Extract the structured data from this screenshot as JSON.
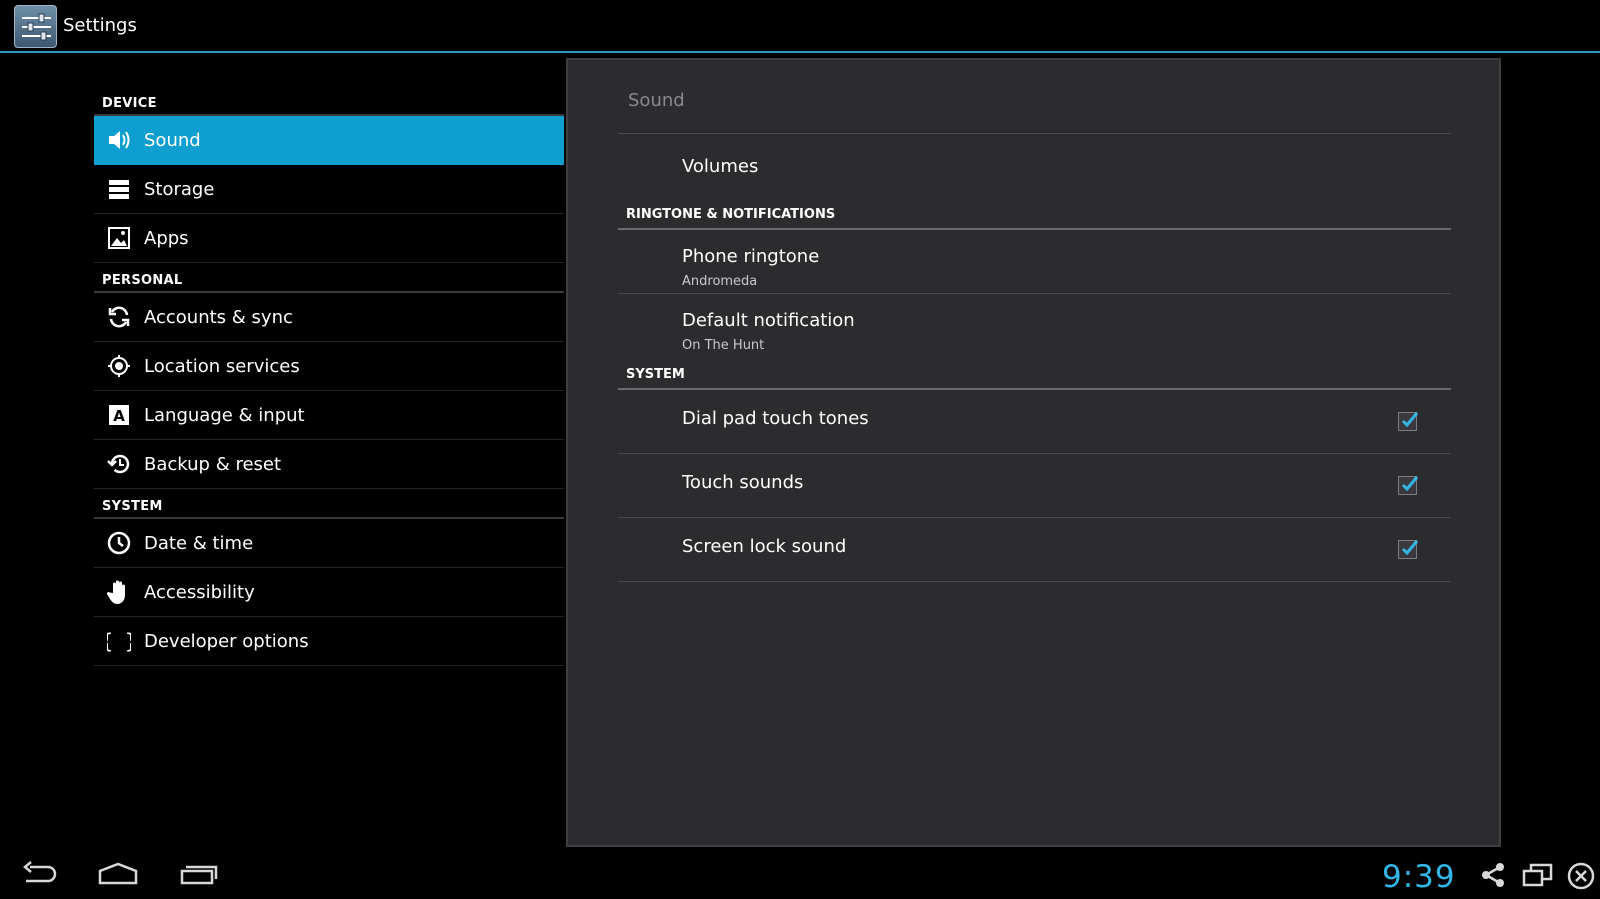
{
  "app": {
    "title": "Settings",
    "icon": "settings-sliders-icon"
  },
  "left_nav": {
    "sections": [
      {
        "header": "DEVICE",
        "items": [
          {
            "label": "Sound",
            "icon": "speaker-icon",
            "selected": true
          },
          {
            "label": "Storage",
            "icon": "storage-icon"
          },
          {
            "label": "Apps",
            "icon": "apps-icon"
          }
        ]
      },
      {
        "header": "PERSONAL",
        "items": [
          {
            "label": "Accounts & sync",
            "icon": "sync-icon"
          },
          {
            "label": "Location services",
            "icon": "location-icon"
          },
          {
            "label": "Language & input",
            "icon": "language-icon"
          },
          {
            "label": "Backup & reset",
            "icon": "backup-icon"
          }
        ]
      },
      {
        "header": "SYSTEM",
        "items": [
          {
            "label": "Date & time",
            "icon": "clock-icon"
          },
          {
            "label": "Accessibility",
            "icon": "hand-icon"
          },
          {
            "label": "Developer options",
            "icon": "braces-icon"
          }
        ]
      }
    ]
  },
  "detail": {
    "title": "Sound",
    "volumes": "Volumes",
    "categories": [
      {
        "header": "RINGTONE & NOTIFICATIONS",
        "items": [
          {
            "title": "Phone ringtone",
            "summary": "Andromeda"
          },
          {
            "title": "Default notification",
            "summary": "On The Hunt"
          }
        ]
      },
      {
        "header": "SYSTEM",
        "items": [
          {
            "title": "Dial pad touch tones",
            "checked": true
          },
          {
            "title": "Touch sounds",
            "checked": true
          },
          {
            "title": "Screen lock sound",
            "checked": true
          }
        ]
      }
    ]
  },
  "system_bar": {
    "clock": "9:39",
    "accent_color": "#33b5e5",
    "buttons": [
      "back-icon",
      "home-icon",
      "recent-apps-icon",
      "share-icon",
      "window-icon",
      "close-circle-icon"
    ]
  },
  "colors": {
    "selected_item": "#0e9fd0",
    "panel_bg": "#2c2c2f",
    "accent": "#33b5e5",
    "checkmark": "#33b5e5"
  }
}
